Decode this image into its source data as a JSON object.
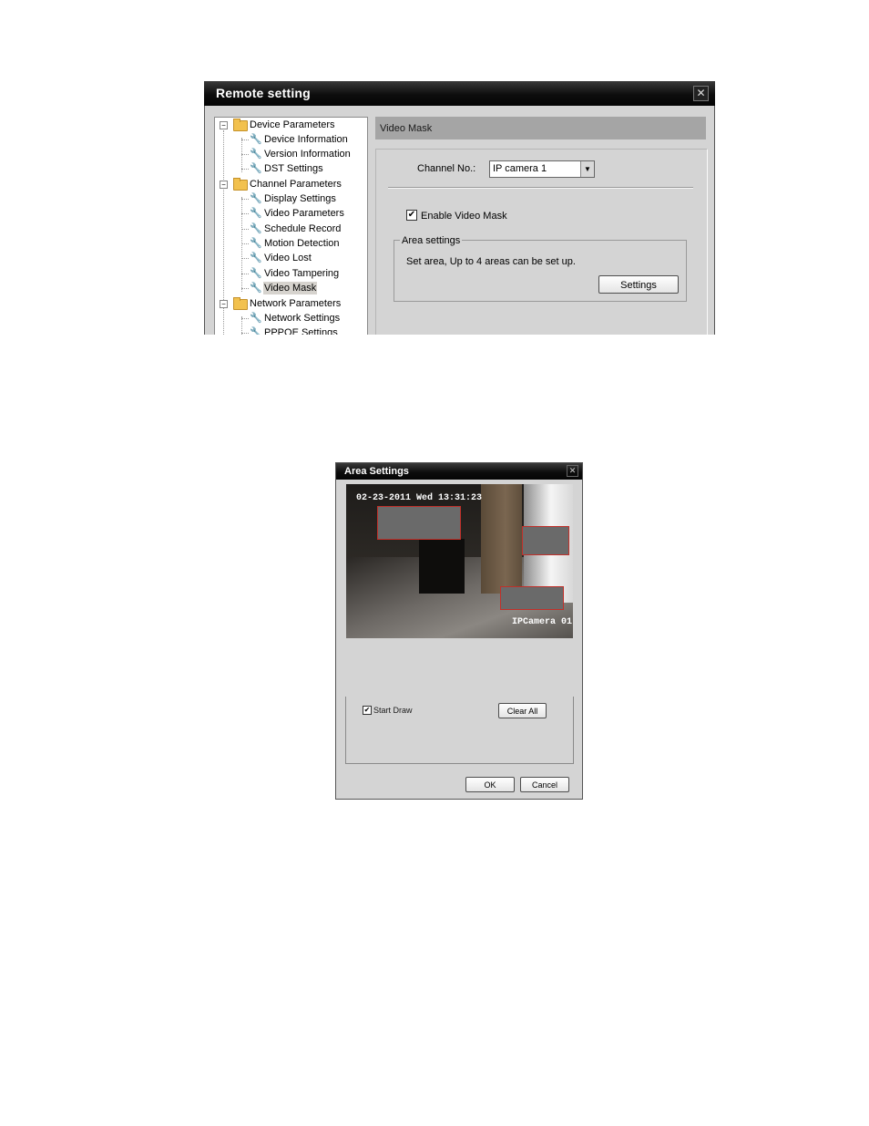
{
  "remote_setting": {
    "title": "Remote setting",
    "close_glyph": "✕",
    "tree": {
      "expander_glyph": "−",
      "wrench_glyph": "🔧",
      "groups": [
        {
          "label": "Device Parameters",
          "items": [
            "Device Information",
            "Version Information",
            "DST Settings"
          ]
        },
        {
          "label": "Channel Parameters",
          "items": [
            "Display Settings",
            "Video Parameters",
            "Schedule Record",
            "Motion Detection",
            "Video Lost",
            "Video Tampering",
            "Video Mask"
          ]
        },
        {
          "label": "Network Parameters",
          "items": [
            "Network Settings",
            "PPPOE Settings"
          ]
        }
      ],
      "selected": "Video Mask"
    },
    "panel": {
      "header": "Video Mask",
      "channel_label": "Channel No.:",
      "channel_value": "IP camera 1",
      "dropdown_glyph": "▼",
      "enable_label": "Enable Video Mask",
      "enable_checked": true,
      "check_glyph": "✔",
      "area_group_label": "Area settings",
      "area_text": "Set area, Up to 4 areas can be set up.",
      "settings_button": "Settings"
    }
  },
  "area_settings": {
    "title": "Area Settings",
    "close_glyph": "✕",
    "video": {
      "timestamp": "02-23-2011 Wed 13:31:23",
      "camera_name": "IPCamera 01",
      "mask_count": 3
    },
    "start_draw_label": "Start Draw",
    "start_draw_checked": true,
    "check_glyph": "✔",
    "clear_all_button": "Clear All",
    "ok_button": "OK",
    "cancel_button": "Cancel"
  },
  "colors": {
    "titlebar": "#0d0d0d",
    "panel_bg": "#d4d4d4",
    "mask_fill": "#6a6a6a",
    "mask_border": "#c0302a"
  }
}
